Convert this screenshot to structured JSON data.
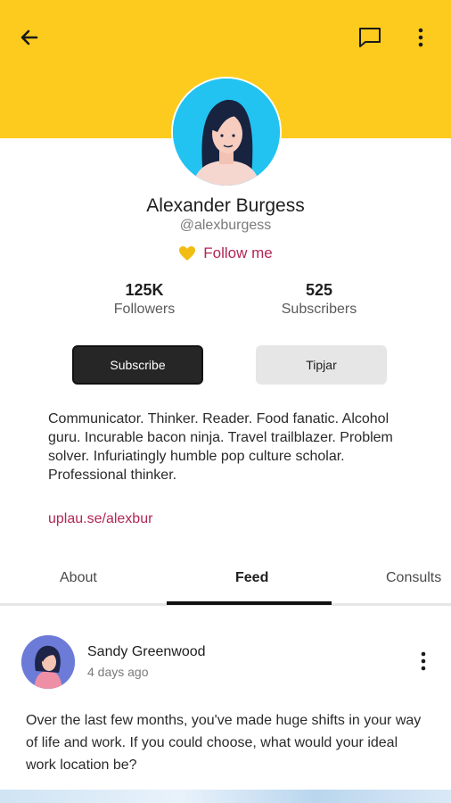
{
  "profile": {
    "name": "Alexander Burgess",
    "handle": "@alexburgess",
    "follow_label": "Follow me",
    "bio": "Communicator. Thinker. Reader. Food fanatic. Alcohol guru. Incurable bacon ninja. Travel trailblazer. Problem solver.  Infuriatingly humble pop culture scholar. Professional thinker.",
    "link": "uplau.se/alexbur"
  },
  "stats": {
    "followers_value": "125K",
    "followers_label": "Followers",
    "subscribers_value": "525",
    "subscribers_label": "Subscribers"
  },
  "buttons": {
    "subscribe": "Subscribe",
    "tipjar": "Tipjar"
  },
  "tabs": {
    "about": "About",
    "feed": "Feed",
    "consults": "Consults",
    "active": "Feed"
  },
  "post": {
    "author": "Sandy Greenwood",
    "time": "4 days ago",
    "text": "Over the last few months, you've made huge shifts in your way of life and work. If you could choose, what would your ideal work location be?"
  },
  "colors": {
    "header_bg": "#fccb1e",
    "accent": "#b22654",
    "subscribe_bg": "#262626",
    "tipjar_bg": "#e6e6e6"
  },
  "icons": [
    "back-arrow-icon",
    "chat-icon",
    "more-vertical-icon",
    "heart-icon"
  ]
}
